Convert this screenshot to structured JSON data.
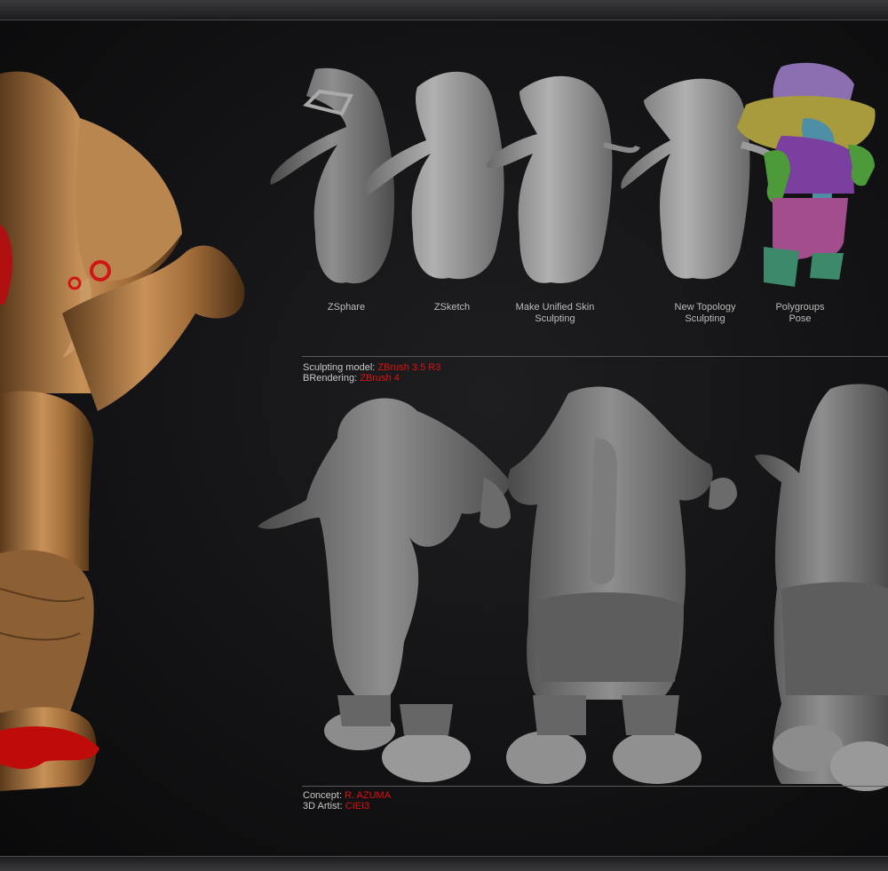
{
  "stages": [
    {
      "line1": "ZSphare",
      "line2": ""
    },
    {
      "line1": "ZSketch",
      "line2": ""
    },
    {
      "line1": "Make Unified Skin",
      "line2": "Sculpting"
    },
    {
      "line1": "New Topology",
      "line2": "Sculpting"
    },
    {
      "line1": "Polygroups",
      "line2": "Pose"
    }
  ],
  "model_info": {
    "sculpt_label": "Sculpting model:",
    "sculpt_value": "ZBrush 3.5 R3",
    "render_label": "BRendering:",
    "render_value": "ZBrush 4"
  },
  "credits": {
    "concept_label": "Concept:",
    "concept_value": "R. AZUMA",
    "artist_label": "3D Artist:",
    "artist_value": "CIEI3"
  },
  "colors": {
    "bronze": "#b07a45",
    "clay": "#8a8a8a",
    "accent_red": "#e01010"
  }
}
